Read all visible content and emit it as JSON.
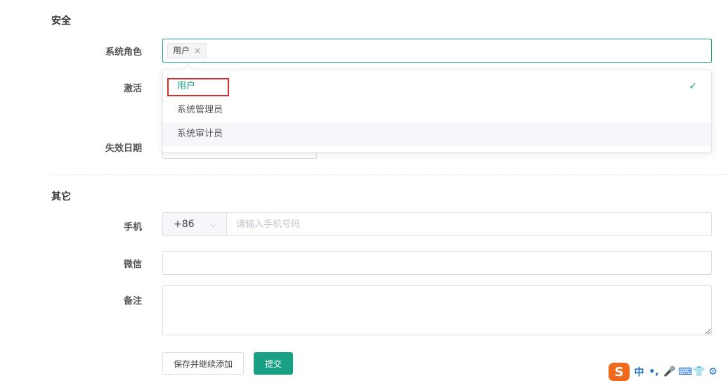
{
  "sections": {
    "security": "安全",
    "other": "其它"
  },
  "labels": {
    "role": "系统角色",
    "activate": "激活",
    "expiry": "失效日期",
    "phone": "手机",
    "wechat": "微信",
    "remark": "备注"
  },
  "role_select": {
    "tags": [
      {
        "label": "用户",
        "close_glyph": "×"
      }
    ]
  },
  "dropdown": {
    "options": [
      {
        "label": "用户",
        "selected": true
      },
      {
        "label": "系统管理员",
        "selected": false
      },
      {
        "label": "系统审计员",
        "selected": false
      }
    ],
    "check_glyph": "✓"
  },
  "phone": {
    "country_code": "+86",
    "chevron_glyph": "⌵",
    "placeholder": "请输入手机号码",
    "value": ""
  },
  "wechat": {
    "value": ""
  },
  "remark": {
    "value": ""
  },
  "buttons": {
    "save_continue": "保存并继续添加",
    "submit": "提交"
  },
  "ime_bar": {
    "logo": "S",
    "items": [
      "中",
      "•,",
      "🎤",
      "⌨",
      "👕",
      "⚙"
    ]
  },
  "colors": {
    "accent": "#18a085",
    "highlight": "#d92b2b",
    "ime_orange": "#ef6a1d",
    "ime_blue": "#1a6fd0"
  }
}
